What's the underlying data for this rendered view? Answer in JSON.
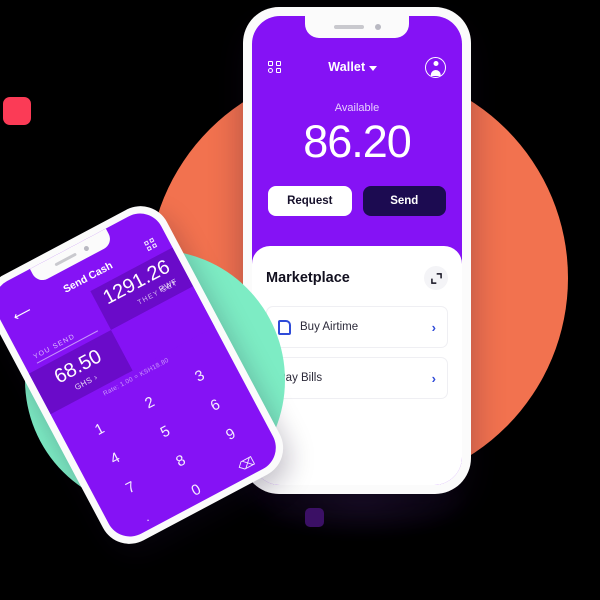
{
  "scene": {
    "colors": {
      "purple": "#8512F5",
      "purple_dark": "#6A0BC9",
      "navy": "#1C0B51",
      "orange": "#F2724F",
      "mint": "#7DECC4",
      "red": "#FB3B56",
      "deco_purple": "#3B1065",
      "accent_blue": "#2F4BD8",
      "white": "#FFFFFF"
    }
  },
  "wallet_phone": {
    "topbar": {
      "grid_icon": "grid-icon",
      "title": "Wallet",
      "chevron_icon": "chevron-down-icon",
      "avatar_icon": "avatar-icon"
    },
    "balance": {
      "label": "Available",
      "amount": "86.20"
    },
    "actions": {
      "request_label": "Request",
      "send_label": "Send"
    },
    "marketplace": {
      "title": "Marketplace",
      "expand_icon": "expand-icon",
      "rows": [
        {
          "label": "Buy Airtime",
          "icon": "sim-card-icon",
          "chevron": "›"
        },
        {
          "label": "Pay Bills",
          "icon": "",
          "chevron": "›"
        }
      ]
    }
  },
  "send_cash_phone": {
    "topbar": {
      "back_icon": "back-arrow-icon",
      "title": "Send Cash",
      "grid_icon": "grid-icon"
    },
    "exchange": {
      "you_send_label": "YOU SEND",
      "they_get_label": "THEY GET",
      "send_amount": "68.50",
      "send_currency": "GHS ›",
      "get_amount": "1291.26",
      "get_currency": "RWF",
      "rate_line": "Rate: 1.00 = KSH18.80"
    },
    "keypad": {
      "keys": [
        "1",
        "2",
        "3",
        "4",
        "5",
        "6",
        "7",
        "8",
        "9",
        ".",
        "0",
        "⌫"
      ]
    }
  }
}
